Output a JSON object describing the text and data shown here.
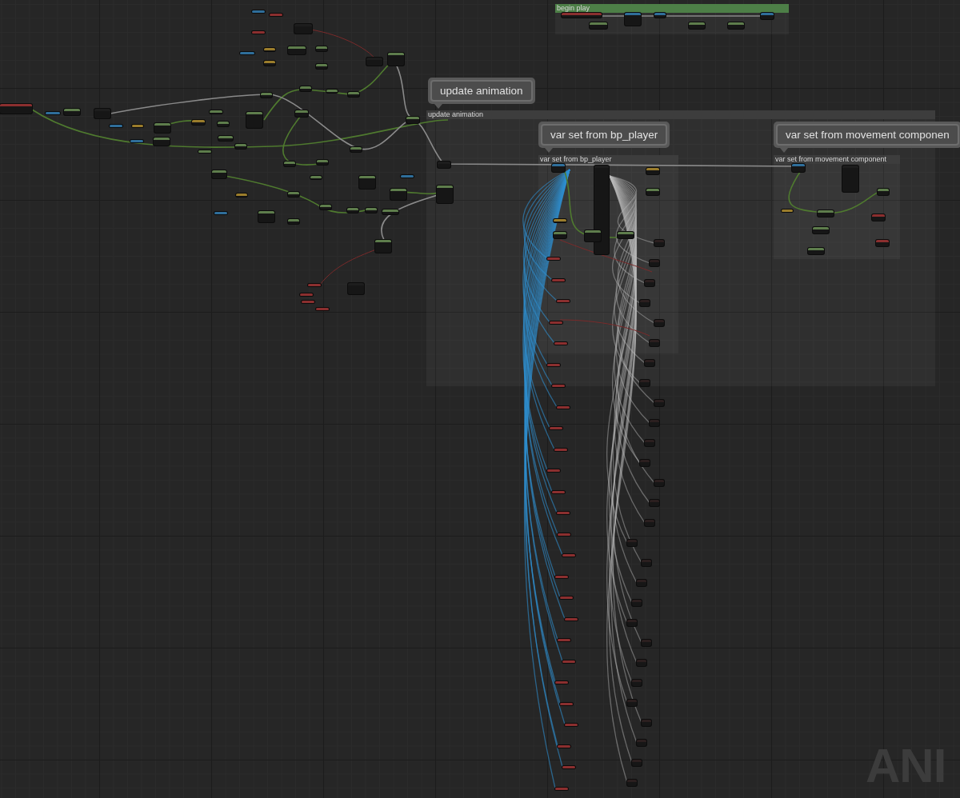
{
  "comments": [
    {
      "kind": "group",
      "title": "begin play",
      "color": "#4d7f47"
    },
    {
      "kind": "bubble",
      "bubble": "update animation",
      "title": "update animation",
      "color": "#3d3d3d"
    },
    {
      "kind": "bubble",
      "bubble": "var set from bp_player",
      "title": "var set from bp_player",
      "color": "#3d3d3d"
    },
    {
      "kind": "bubble",
      "bubble": "var set from movement componen",
      "title": "var set from movement component",
      "color": "#3d3d3d"
    }
  ],
  "graph_type_label": "ANI"
}
